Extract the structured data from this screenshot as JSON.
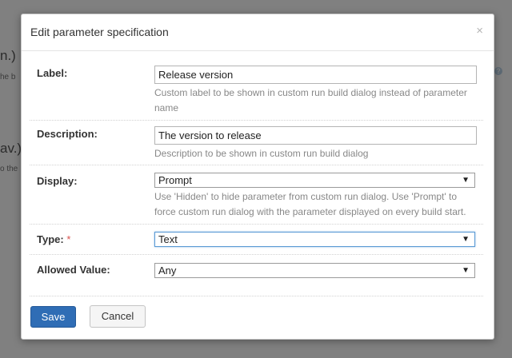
{
  "background": {
    "heading_1": "n.)",
    "subtext_1": "he b",
    "heading_2": "av.)",
    "subtext_2": "o the",
    "help_icon": "question-icon"
  },
  "dialog": {
    "title": "Edit parameter specification",
    "close_symbol": "×",
    "fields": {
      "label": {
        "label": "Label:",
        "value": "Release version",
        "note": "Custom label to be shown in custom run build dialog instead of parameter name"
      },
      "description": {
        "label": "Description:",
        "value": "The version to release",
        "note": "Description to be shown in custom run build dialog"
      },
      "display": {
        "label": "Display:",
        "value": "Prompt",
        "note": "Use 'Hidden' to hide parameter from custom run dialog. Use 'Prompt' to force custom run dialog with the parameter displayed on every build start."
      },
      "type": {
        "label": "Type:",
        "required_mark": "*",
        "value": "Text"
      },
      "allowed_value": {
        "label": "Allowed Value:",
        "value": "Any"
      }
    },
    "buttons": {
      "save": "Save",
      "cancel": "Cancel"
    }
  },
  "colors": {
    "primary_button": "#2f6db5",
    "required": "#d9534f",
    "focus_border": "#5b9bd5"
  }
}
